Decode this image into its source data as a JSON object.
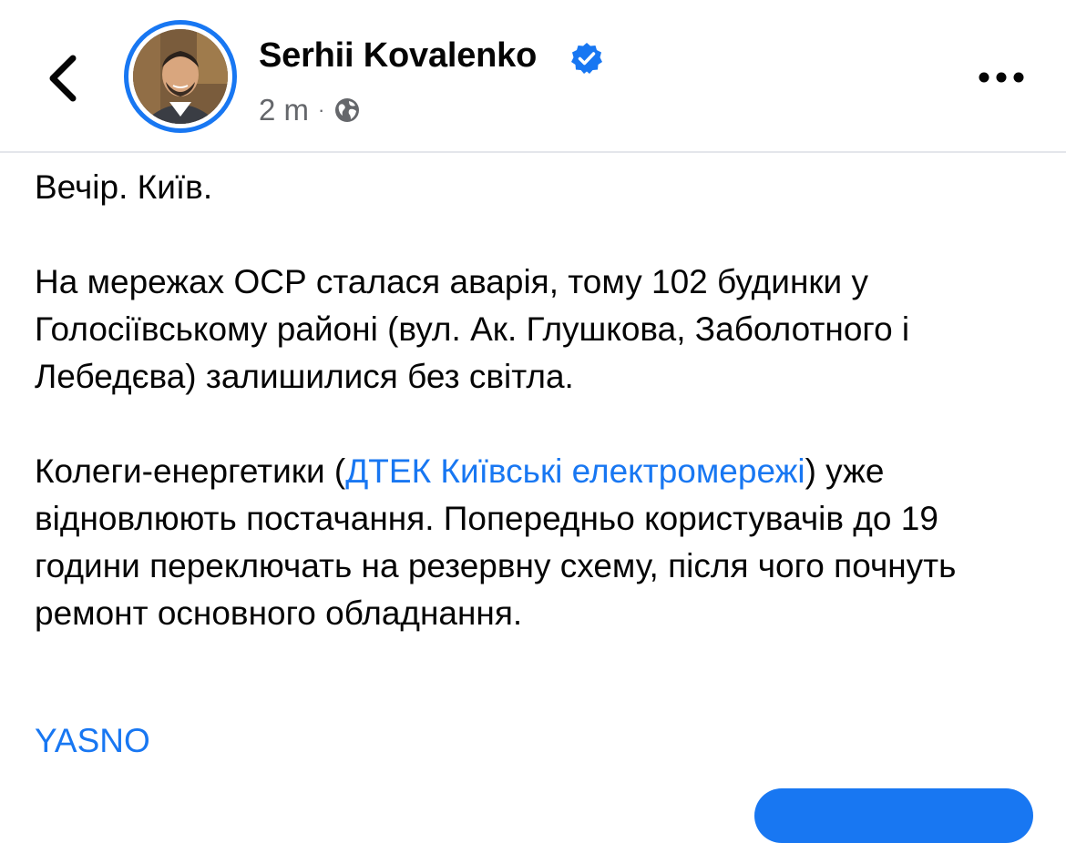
{
  "header": {
    "back_icon": "chevron-left-icon",
    "author_name": "Serhii Kovalenko",
    "verified_icon": "verified-badge-icon",
    "timestamp": "2 m",
    "separator": "·",
    "audience_icon": "globe-icon",
    "more_icon": "more-horizontal-icon"
  },
  "post": {
    "line1": "Вечір. Київ.",
    "para2": "На мережах ОСР сталася аварія, тому 102 будинки у Голосіївському районі (вул. Ак. Глушкова, Заболотного і Лебедєва) залишилися без світла.",
    "para3_before": "Колеги-енергетики (",
    "para3_link": "ДТЕК Київські електромережі",
    "para3_after": ") уже відновлюють постачання. Попередньо користувачів до 19 години переключать на резервну схему, після чого почнуть ремонт основного обладнання.",
    "tag_link": "YASNO"
  },
  "colors": {
    "accent": "#1877f2",
    "muted": "#65676b",
    "divider": "#e4e6eb"
  }
}
